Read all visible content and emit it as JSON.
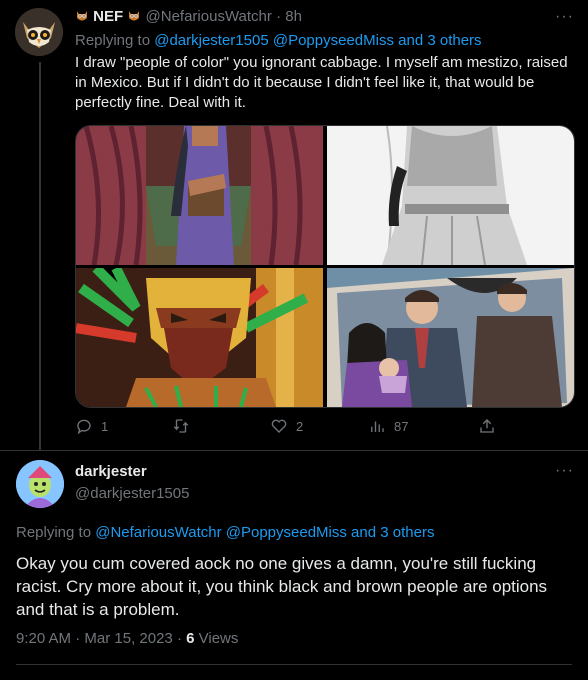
{
  "tweet1": {
    "name": "NEF",
    "handle": "@NefariousWatchr",
    "time": "8h",
    "replying_prefix": "Replying to",
    "replying_users": "@darkjester1505 @PoppyseedMiss",
    "replying_and": "and",
    "replying_others": "3 others",
    "text": "I draw \"people of color\" you ignorant cabbage. I myself am mestizo, raised in Mexico. But if I didn't do it because I didn't feel like it, that would be perfectly fine. Deal with it.",
    "actions": {
      "replies": "1",
      "likes": "2",
      "views": "87"
    }
  },
  "tweet2": {
    "name": "darkjester",
    "handle": "@darkjester1505",
    "replying_prefix": "Replying to",
    "replying_users": "@NefariousWatchr @PoppyseedMiss",
    "replying_and": "and",
    "replying_others": "3 others",
    "text": "Okay you cum covered aock no one gives a damn, you're still fucking racist. Cry more about it, you think black and brown people are options and that is a problem.",
    "time": "9:20 AM",
    "date": "Mar 15, 2023",
    "views_count": "6",
    "views_label": "Views"
  },
  "colors": {
    "accent": "#1d9bf0",
    "muted": "#71767b",
    "text": "#e7e9ea",
    "bg": "#000000"
  }
}
